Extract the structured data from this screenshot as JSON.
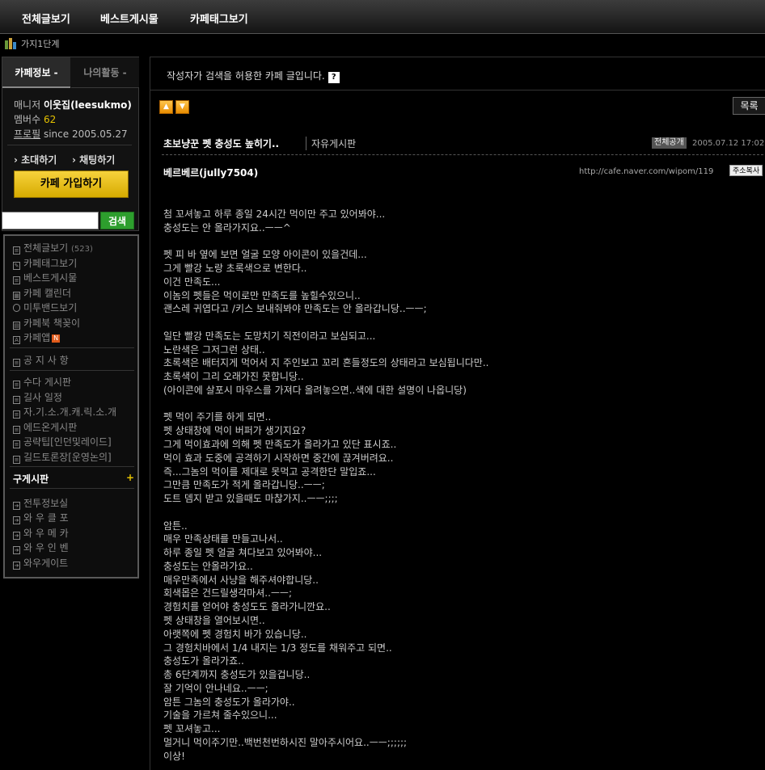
{
  "topnav": {
    "tabs": [
      "전체글보기",
      "베스트게시물",
      "카페태그보기"
    ]
  },
  "level": {
    "text": "가지1단계"
  },
  "sidebar": {
    "tabs": [
      "카페정보 -",
      "나의활동 -"
    ],
    "manager_label": "매니저",
    "manager_name": "이웃집(leesukmo)",
    "members_label": "멤버수",
    "members_count": "62",
    "profile_label": "프로필",
    "since": "since 2005.05.27",
    "invite": "초대하기",
    "chat": "채팅하기",
    "join_button": "카페 가입하기",
    "search_button": "검색",
    "menu": [
      {
        "label": "전체글보기",
        "count": "(523)"
      },
      {
        "label": "카페태그보기"
      },
      {
        "label": "베스트게시물"
      },
      {
        "label": "카페 캘린더"
      },
      {
        "label": "미투밴드보기"
      },
      {
        "label": "카페북 책꽂이"
      },
      {
        "label": "카페앱",
        "badge": "N"
      },
      {
        "label": "공 지 사 항"
      },
      {
        "label": "수다 게시판"
      },
      {
        "label": "길사 일정"
      },
      {
        "label": "자.기.소.개.캐.릭.소.개"
      },
      {
        "label": "에드온게시판"
      },
      {
        "label": "공략팁[인던및레이드]"
      },
      {
        "label": "길드토론장[운영논의]"
      }
    ],
    "gu_title": "구게시판",
    "gu_plus": "+",
    "gu_menu": [
      "전투정보실",
      "와 우 클 포",
      "와 우 메 카",
      "와 우 인 벤",
      "와우게이트"
    ]
  },
  "main": {
    "notice": "작성자가 검색을 허용한 카페 글입니다.",
    "help": "?",
    "list_button": "목록",
    "post": {
      "title": "초보냥꾼 펫 충성도 높히기..",
      "board": "자유게시판",
      "visibility": "전체공개",
      "date": "2005.07.12 17:02",
      "author": "베르베르(jully7504)",
      "url": "http://cafe.naver.com/wipom/119",
      "copy_url": "주소복사",
      "body": [
        "첨 꼬셔놓고 하루 종일 24시간 먹이만 주고 있어봐야...",
        "충성도는 안 올라가지요..ㅡㅡ^",
        "",
        "펫 피 바 옆에 보면 얼굴 모양 아이콘이 있을건데...",
        "그게 빨강 노랑 초록색으로 변한다..",
        "이건 만족도...",
        "이놈의 펫들은 먹이로만 만족도를 높힐수있으니..",
        "괜스레 귀엽다고 /키스 보내줘봐야 만족도는 안 올라갑니당..ㅡㅡ;",
        "",
        "일단 빨강 만족도는 도망치기 직전이라고 보심되고...",
        "노란색은 그저그런 상태..",
        "초록색은 배터지게 먹어서 지 주인보고 꼬리 흔들정도의 상태라고 보심됩니다만..",
        "초록색이 그리 오래가진 못합니당..",
        "(아이콘에 살포시 마우스를 가져다 올려놓으면..색에 대한 설명이 나옵니당)",
        "",
        "펫 먹이 주기를 하게 되면..",
        "펫 상태창에 먹이 버퍼가 생기지요?",
        "그게 먹이효과에 의해 펫 만족도가 올라가고 있단 표시죠..",
        "먹이 효과 도중에 공격하기 시작하면 중간에 끊겨버려요..",
        "즉...그놈의 먹이를 제대로 못먹고 공격한단 말입죠...",
        "그만큼 만족도가 적게 올라갑니당..ㅡㅡ;",
        "도트 뎀지 받고 있을때도 마찮가지..ㅡㅡ;;;;",
        "",
        "암튼..",
        "매우 만족상태를 만들고나서..",
        "하루 종일 펫 얼굴 쳐다보고 있어봐야...",
        "충성도는 안올라가요..",
        "매우만족에서 사냥을 해주셔야합니당..",
        "회색몹은 건드릴생각마셔..ㅡㅡ;",
        "경험치를 얻어야 충성도도 올라가니깐요..",
        "펫 상태창을 열어보시면..",
        "아랫쪽에 펫 경험치 바가 있습니당..",
        "그 경험치바에서 1/4 내지는 1/3 정도를 채워주고 되면..",
        "충성도가 올라가죠..",
        "총 6단계까지 충성도가 있을겁니당..",
        "잘 기억이 안나네요..ㅡㅡ;",
        "암튼 그놈의 충성도가 올라가야..",
        "기술을 가르쳐 줄수있으니...",
        "펫 꼬셔놓고...",
        "멀거니 먹이주기만..백번천번하시진 말아주시어요..ㅡㅡ;;;;;;",
        "이상!"
      ]
    }
  }
}
